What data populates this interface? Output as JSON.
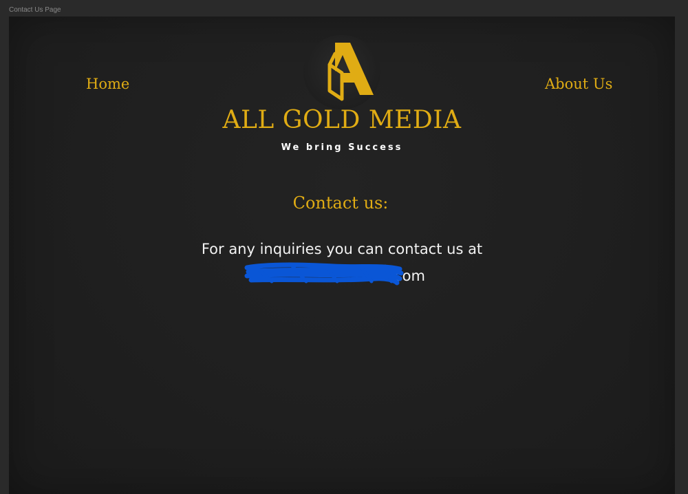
{
  "frame": {
    "label": "Contact Us Page"
  },
  "nav": {
    "home_label": "Home",
    "about_label": "About Us"
  },
  "logo": {
    "icon": "letter-a-logo-icon",
    "brand_name": "ALL GOLD MEDIA",
    "tagline": "We bring Success"
  },
  "contact": {
    "heading": "Contact us:",
    "text": "For any inquiries you can contact us at",
    "email_visible": "com",
    "email_redaction": "blue-scribble-redaction"
  },
  "colors": {
    "gold": "#e0ac14",
    "background": "#1f1f1f",
    "text": "#f2f2f2",
    "redaction": "#0a56d6"
  }
}
